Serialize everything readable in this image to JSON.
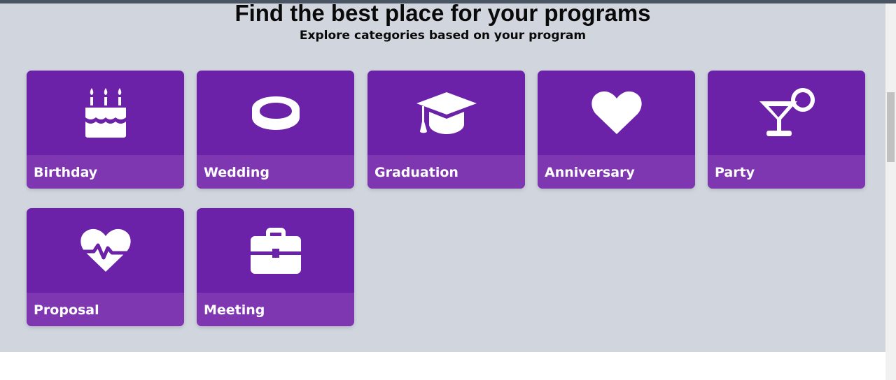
{
  "header": {
    "title": "Find the best place for your programs",
    "subtitle": "Explore categories based on your program"
  },
  "categories": [
    {
      "label": "Birthday",
      "icon": "birthday-cake-icon"
    },
    {
      "label": "Wedding",
      "icon": "ring-icon"
    },
    {
      "label": "Graduation",
      "icon": "graduation-cap-icon"
    },
    {
      "label": "Anniversary",
      "icon": "heart-icon"
    },
    {
      "label": "Party",
      "icon": "cocktail-icon"
    },
    {
      "label": "Proposal",
      "icon": "heart-pulse-icon"
    },
    {
      "label": "Meeting",
      "icon": "briefcase-icon"
    }
  ],
  "colors": {
    "section_background": "#d1d5de",
    "card_background": "#6b21a8",
    "card_label_background": "#7e37b0",
    "card_text": "#ffffff"
  }
}
